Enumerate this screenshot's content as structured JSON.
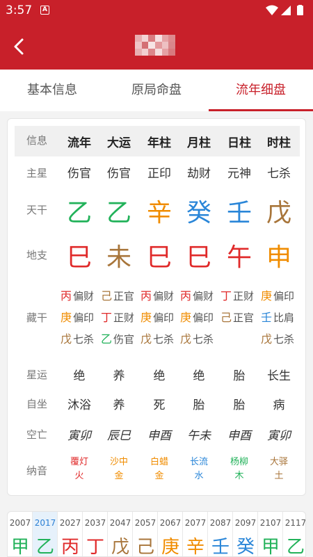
{
  "status_bar": {
    "time": "3:57",
    "notif_letter": "A"
  },
  "colors": {
    "wood": "#22b25a",
    "fire": "#e02a2a",
    "earth": "#a8753a",
    "metal": "#f08c00",
    "water": "#2a86d8",
    "brand": "#c8202a"
  },
  "tabs": [
    {
      "label": "基本信息",
      "active": false
    },
    {
      "label": "原局命盘",
      "active": false
    },
    {
      "label": "流年细盘",
      "active": true
    }
  ],
  "table": {
    "header_label": "信息",
    "columns": [
      "流年",
      "大运",
      "年柱",
      "月柱",
      "日柱",
      "时柱"
    ],
    "shishen_label": "主星",
    "shishen": [
      "伤官",
      "伤官",
      "正印",
      "劫财",
      "元神",
      "七杀"
    ],
    "tiangan_label": "天干",
    "tiangan": [
      {
        "char": "乙",
        "el": "wood"
      },
      {
        "char": "乙",
        "el": "wood"
      },
      {
        "char": "辛",
        "el": "metal"
      },
      {
        "char": "癸",
        "el": "water"
      },
      {
        "char": "壬",
        "el": "water"
      },
      {
        "char": "戊",
        "el": "earth"
      }
    ],
    "dizhi_label": "地支",
    "dizhi": [
      {
        "char": "巳",
        "el": "fire"
      },
      {
        "char": "未",
        "el": "earth"
      },
      {
        "char": "巳",
        "el": "fire"
      },
      {
        "char": "巳",
        "el": "fire"
      },
      {
        "char": "午",
        "el": "fire"
      },
      {
        "char": "申",
        "el": "metal"
      }
    ],
    "canggan_label": "藏干",
    "canggan": [
      [
        {
          "char": "丙",
          "el": "fire",
          "name": "偏财"
        },
        {
          "char": "庚",
          "el": "metal",
          "name": "偏印"
        },
        {
          "char": "戊",
          "el": "earth",
          "name": "七杀"
        }
      ],
      [
        {
          "char": "己",
          "el": "earth",
          "name": "正官"
        },
        {
          "char": "丁",
          "el": "fire",
          "name": "正财"
        },
        {
          "char": "乙",
          "el": "wood",
          "name": "伤官"
        }
      ],
      [
        {
          "char": "丙",
          "el": "fire",
          "name": "偏财"
        },
        {
          "char": "庚",
          "el": "metal",
          "name": "偏印"
        },
        {
          "char": "戊",
          "el": "earth",
          "name": "七杀"
        }
      ],
      [
        {
          "char": "丙",
          "el": "fire",
          "name": "偏财"
        },
        {
          "char": "庚",
          "el": "metal",
          "name": "偏印"
        },
        {
          "char": "戊",
          "el": "earth",
          "name": "七杀"
        }
      ],
      [
        {
          "char": "丁",
          "el": "fire",
          "name": "正财"
        },
        {
          "char": "己",
          "el": "earth",
          "name": "正官"
        }
      ],
      [
        {
          "char": "庚",
          "el": "metal",
          "name": "偏印"
        },
        {
          "char": "壬",
          "el": "water",
          "name": "比肩"
        },
        {
          "char": "戊",
          "el": "earth",
          "name": "七杀"
        }
      ]
    ],
    "xingyun_label": "星运",
    "xingyun": [
      "绝",
      "养",
      "绝",
      "绝",
      "胎",
      "长生"
    ],
    "zizuo_label": "自坐",
    "zizuo": [
      "沐浴",
      "养",
      "死",
      "胎",
      "胎",
      "病"
    ],
    "kongwang_label": "空亡",
    "kongwang": [
      "寅卯",
      "辰巳",
      "申酉",
      "午未",
      "申酉",
      "寅卯"
    ],
    "nayin_label": "纳音",
    "nayin": [
      {
        "l1": "覆灯",
        "l2": "火",
        "el": "fire"
      },
      {
        "l1": "沙中",
        "l2": "金",
        "el": "metal"
      },
      {
        "l1": "白蜡",
        "l2": "金",
        "el": "metal"
      },
      {
        "l1": "长流",
        "l2": "水",
        "el": "water"
      },
      {
        "l1": "杨柳",
        "l2": "木",
        "el": "wood"
      },
      {
        "l1": "大驿",
        "l2": "土",
        "el": "earth"
      }
    ]
  },
  "timeline": {
    "selected_index": 1,
    "years": [
      {
        "year": "2007",
        "gan": "甲",
        "el": "wood"
      },
      {
        "year": "2017",
        "gan": "乙",
        "el": "wood"
      },
      {
        "year": "2027",
        "gan": "丙",
        "el": "fire"
      },
      {
        "year": "2037",
        "gan": "丁",
        "el": "fire"
      },
      {
        "year": "2047",
        "gan": "戊",
        "el": "earth"
      },
      {
        "year": "2057",
        "gan": "己",
        "el": "earth"
      },
      {
        "year": "2067",
        "gan": "庚",
        "el": "metal"
      },
      {
        "year": "2077",
        "gan": "辛",
        "el": "metal"
      },
      {
        "year": "2087",
        "gan": "壬",
        "el": "water"
      },
      {
        "year": "2097",
        "gan": "癸",
        "el": "water"
      },
      {
        "year": "2107",
        "gan": "甲",
        "el": "wood"
      },
      {
        "year": "2117",
        "gan": "乙",
        "el": "wood"
      }
    ]
  }
}
